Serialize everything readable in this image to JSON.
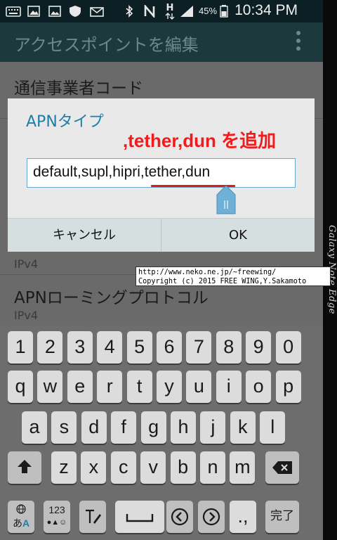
{
  "status_bar": {
    "battery_percent": "45%",
    "time": "10:34 PM",
    "network": "H"
  },
  "action_bar": {
    "title": "アクセスポイントを編集"
  },
  "settings_rows": [
    {
      "title": "通信事業者コード"
    },
    {
      "title": "",
      "sub": "IPv4"
    },
    {
      "title": "APNローミングプロトコル",
      "sub": "IPv4"
    }
  ],
  "dialog": {
    "title": "APNタイプ",
    "value": "default,supl,hipri,tether,dun",
    "cancel_label": "キャンセル",
    "ok_label": "OK"
  },
  "annotation": ",tether,dun を追加",
  "watermark": {
    "line1": "http://www.neko.ne.jp/~freewing/",
    "line2": "Copyright (c) 2015 FREE WING,Y.Sakamoto"
  },
  "edge_text": "Galaxy Note Edge",
  "keyboard": {
    "row_numbers": [
      "1",
      "2",
      "3",
      "4",
      "5",
      "6",
      "7",
      "8",
      "9",
      "0"
    ],
    "row_top": [
      "q",
      "w",
      "e",
      "r",
      "t",
      "y",
      "u",
      "i",
      "o",
      "p"
    ],
    "row_home": [
      "a",
      "s",
      "d",
      "f",
      "g",
      "h",
      "j",
      "k",
      "l"
    ],
    "row_bottom": [
      "z",
      "x",
      "c",
      "v",
      "b",
      "n",
      "m"
    ],
    "lang_key_top": "あ",
    "lang_key_bottom": "A",
    "symbol_key_top": "123",
    "symbol_key_bottom": "●▲☺",
    "punct_key": ".,",
    "done_key": "完了"
  },
  "colors": {
    "accent": "#1f7fa8",
    "annotation": "#f21b1b",
    "action_bar": "#1c3a3e"
  }
}
